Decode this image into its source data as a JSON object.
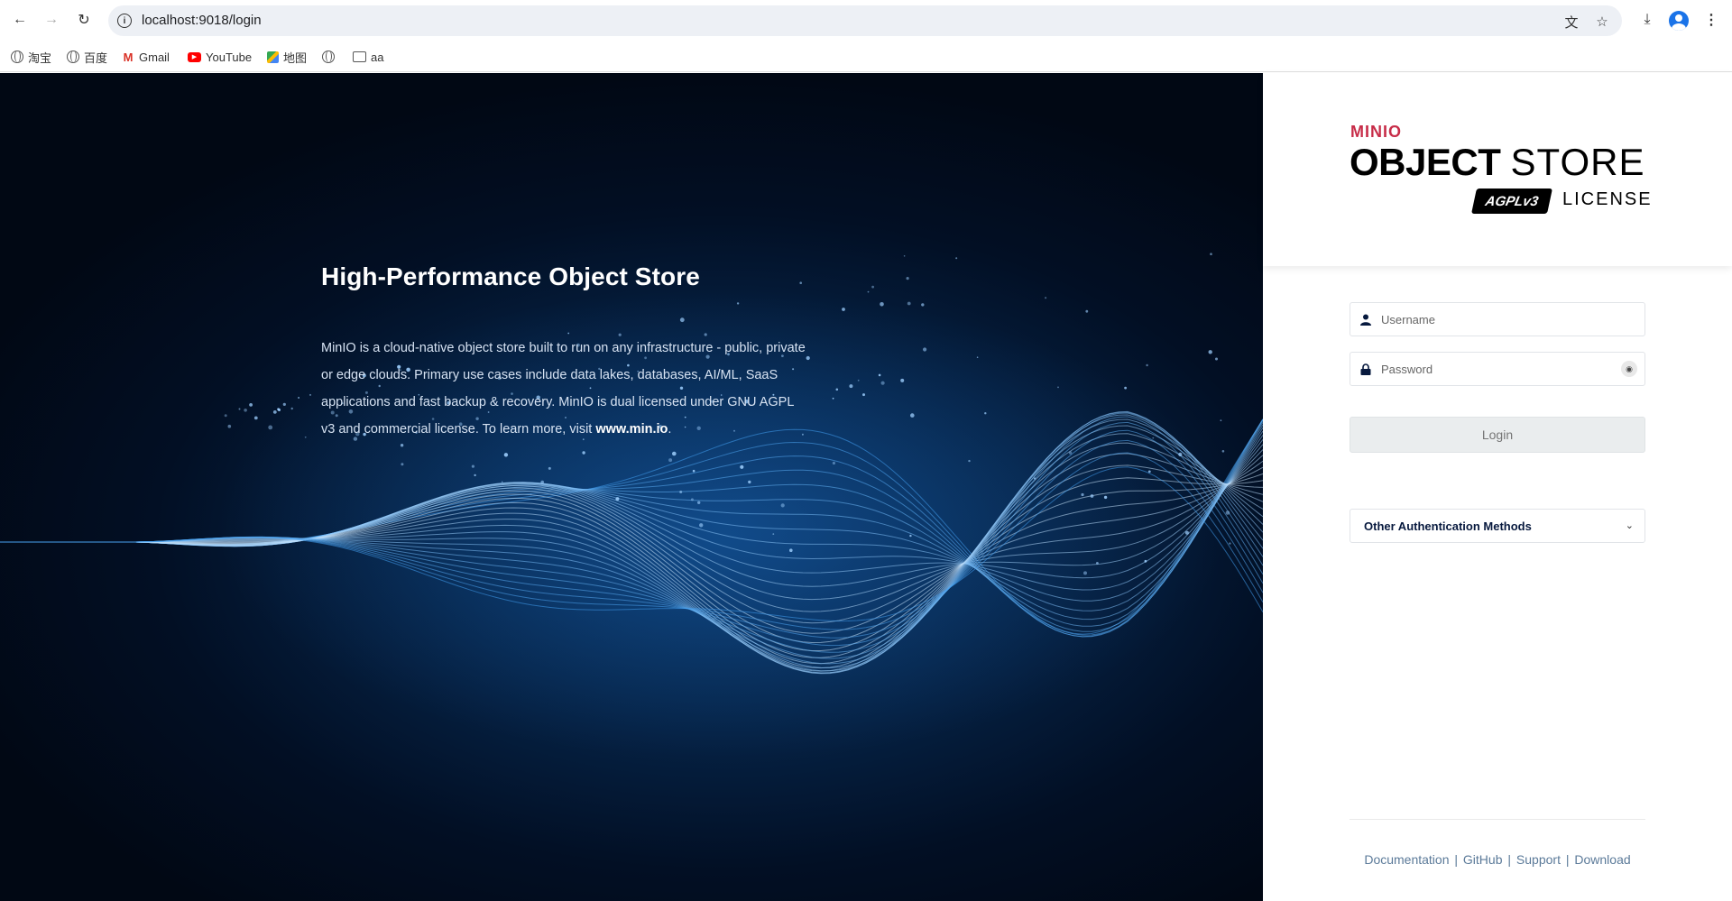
{
  "browser": {
    "url": "localhost:9018/login",
    "bookmarks": [
      {
        "label": "淘宝",
        "icon": "globe-icon"
      },
      {
        "label": "百度",
        "icon": "globe-icon"
      },
      {
        "label": "Gmail",
        "icon": "gmail-icon"
      },
      {
        "label": "YouTube",
        "icon": "youtube-icon"
      },
      {
        "label": "地图",
        "icon": "maps-icon"
      },
      {
        "label": "",
        "icon": "globe-icon"
      },
      {
        "label": "aa",
        "icon": "folder-icon"
      }
    ]
  },
  "hero": {
    "title": "High-Performance Object Store",
    "description": "MinIO is a cloud-native object store built to run on any infrastructure - public, private or edge clouds. Primary use cases include data lakes, databases, AI/ML, SaaS applications and fast backup & recovery. MinIO is dual licensed under GNU AGPL v3 and commercial license. To learn more, visit ",
    "link": "www.min.io",
    "end": "."
  },
  "brand": {
    "minio": "MINIO",
    "object": "OBJECT",
    "store": "STORE",
    "agpl": "AGPLv3",
    "license": "LICENSE"
  },
  "login": {
    "username_placeholder": "Username",
    "password_placeholder": "Password",
    "button": "Login",
    "other_auth": "Other Authentication Methods"
  },
  "footer": {
    "links": [
      "Documentation",
      "GitHub",
      "Support",
      "Download"
    ]
  },
  "colors": {
    "brand_red": "#c72c48",
    "navy": "#07193e",
    "hero_bg": "#020f24",
    "wave": "#5aa9f0"
  }
}
